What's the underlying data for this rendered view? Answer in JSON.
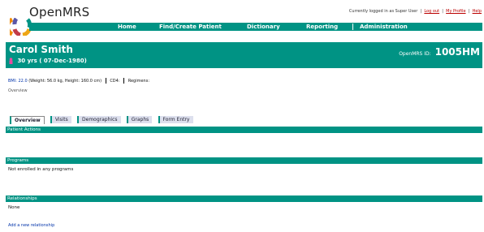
{
  "app": {
    "logo_text": "OpenMRS"
  },
  "userbar": {
    "currently_logged_in": "Currently logged in as Super User",
    "logout": "Log out",
    "my_profile": "My Profile",
    "help": "Help"
  },
  "nav": {
    "items": [
      "Home",
      "Find/Create Patient",
      "Dictionary",
      "Reporting",
      "Administration"
    ]
  },
  "patient": {
    "name": "Carol Smith",
    "age_dob": "30 yrs ( 07-Dec-1980)",
    "id_label": "OpenMRS ID:",
    "id_value": "1005HM",
    "bmi_label": "BMI: 22.0",
    "bmi_detail": "(Weight: 56.0 kg, Height: 160.0 cm)",
    "cd4_label": "CD4:",
    "regimens_label": "Regimens:",
    "overview_link": "Overview"
  },
  "tabs": [
    "Overview",
    "Visits",
    "Demographics",
    "Graphs",
    "Form Entry"
  ],
  "sections": {
    "patient_actions": "Patient Actions",
    "programs": "Programs",
    "programs_body": "Not enrolled in any programs",
    "relationships": "Relationships",
    "relationships_body": "None",
    "add_relationship": "Add a new relationship"
  },
  "colors": {
    "accent": "#009384",
    "tab_bg": "#dde0ee",
    "link_red": "#bb0000"
  }
}
